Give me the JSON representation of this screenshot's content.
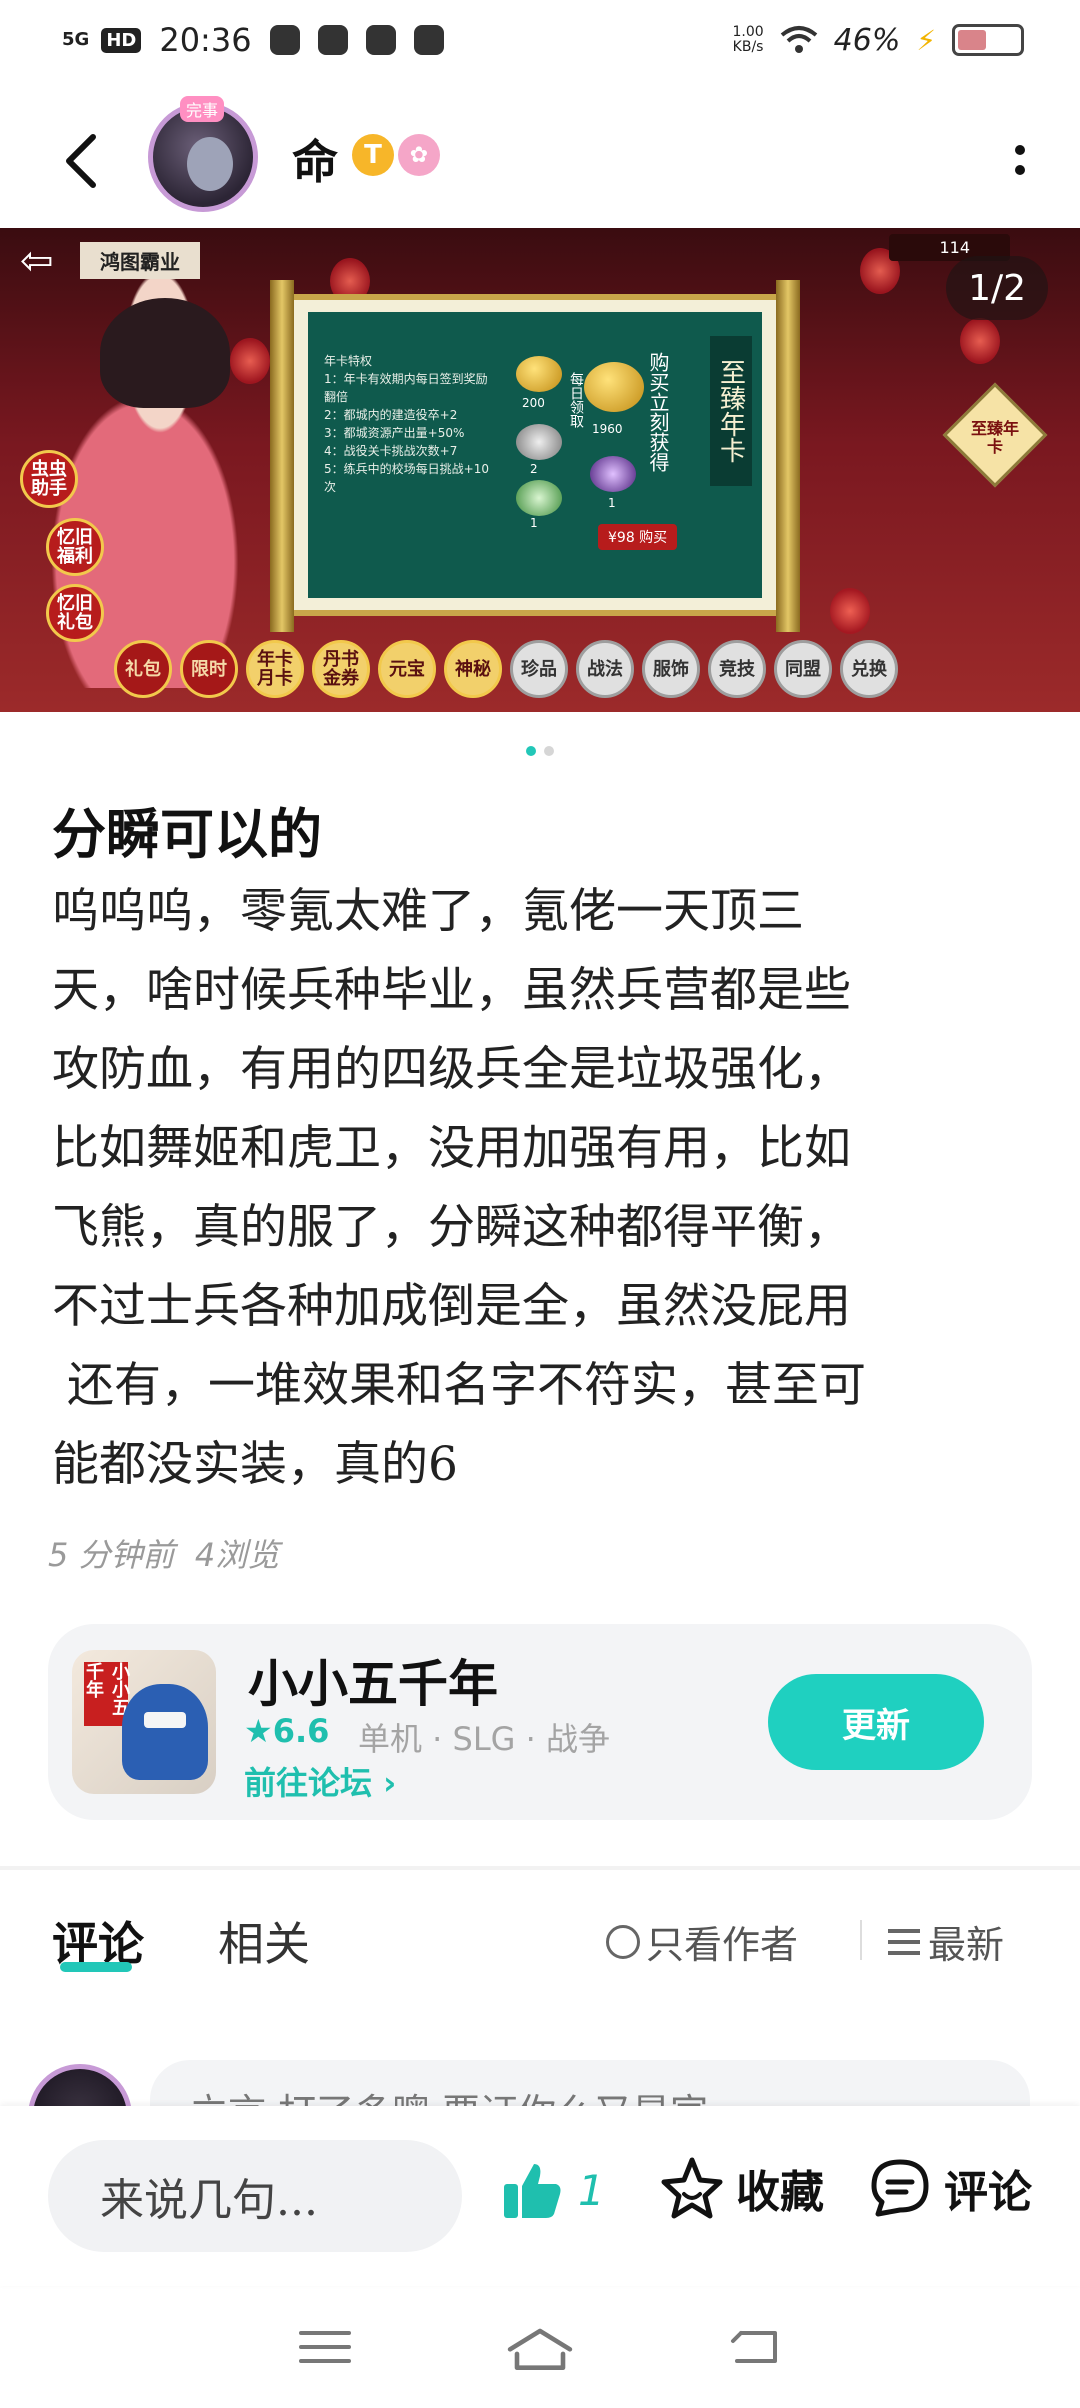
{
  "status_bar": {
    "network": "5G",
    "hd": "HD",
    "time": "20:36",
    "speed_value": "1.00",
    "speed_unit": "KB/s",
    "battery_pct": "46%",
    "battery_level": 0.46
  },
  "header": {
    "username": "命",
    "avatar_badge": "完事",
    "level_badge": "T",
    "vip_badge": "✿"
  },
  "banner": {
    "counter": "1/2",
    "title": "鸿图霸业",
    "coins": "114",
    "side_buttons": [
      "虫虫助手",
      "忆旧福利",
      "忆旧礼包"
    ],
    "perks_title": "年卡特权",
    "perks": [
      "1：年卡有效期内每日签到奖励翻倍",
      "2：都城内的建造役卒+2",
      "3：都城资源产出量+50%",
      "4：战役关卡挑战次数+7",
      "5：练兵中的校场每日挑战+10次"
    ],
    "amounts": [
      "200",
      "2",
      "1",
      "1960",
      "1"
    ],
    "vertical_labels": [
      "每日领取",
      "购买立刻获得"
    ],
    "card_title": "至臻年卡",
    "buy_label": "¥98 购买",
    "diamond_tag": "至臻年卡",
    "menu": [
      {
        "label": "礼包",
        "style": "red"
      },
      {
        "label": "限时",
        "style": "red"
      },
      {
        "label": "年卡月卡",
        "style": "gold"
      },
      {
        "label": "丹书金券",
        "style": "gold"
      },
      {
        "label": "元宝",
        "style": "gold"
      },
      {
        "label": "神秘",
        "style": "gold"
      },
      {
        "label": "珍品",
        "style": "grey"
      },
      {
        "label": "战法",
        "style": "grey"
      },
      {
        "label": "服饰",
        "style": "grey"
      },
      {
        "label": "竞技",
        "style": "grey"
      },
      {
        "label": "同盟",
        "style": "grey"
      },
      {
        "label": "兑换",
        "style": "grey"
      }
    ]
  },
  "post": {
    "title": "分瞬可以的",
    "body_lines": [
      "呜呜呜，零氪太难了，氪佬一天顶三",
      "天，啥时候兵种毕业，虽然兵营都是些",
      "攻防血，有用的四级兵全是垃圾强化，",
      "比如舞姬和虎卫，没用加强有用，比如",
      "飞熊，真的服了，分瞬这种都得平衡，",
      "不过士兵各种加成倒是全，虽然没屁用",
      " 还有，一堆效果和名字不符实，甚至可",
      "能都没实装，真的6"
    ],
    "meta": "5 分钟前  4浏览"
  },
  "app_card": {
    "icon_seal": "小小五千年",
    "name": "小小五千年",
    "rating": "★6.6",
    "tags": "单机 · SLG · 战争",
    "forum_link": "前往论坛",
    "update_label": "更新"
  },
  "tabs": {
    "comments": "评论",
    "related": "相关",
    "author_only": "只看作者",
    "sort": "最新"
  },
  "comment_preview": {
    "text": "立言  打了多噢  要证你么又是官"
  },
  "bottom_bar": {
    "input_placeholder": "来说几句...",
    "like_count": "1",
    "favorite_label": "收藏",
    "comment_label": "评论"
  },
  "colors": {
    "accent": "#1fd0c0",
    "accent_text": "#1fbfae",
    "banner_bg": "#7a1820"
  }
}
